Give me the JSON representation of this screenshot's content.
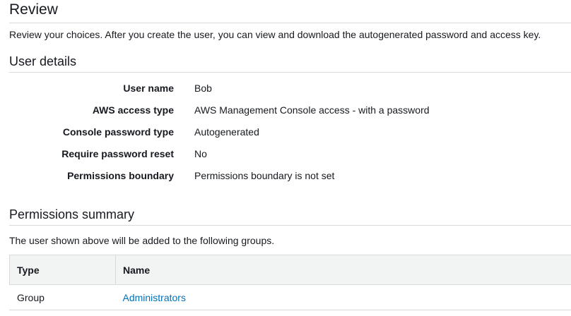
{
  "page": {
    "title": "Review",
    "intro": "Review your choices. After you create the user, you can view and download the autogenerated password and access key."
  },
  "user_details": {
    "title": "User details",
    "rows": [
      {
        "label": "User name",
        "value": "Bob"
      },
      {
        "label": "AWS access type",
        "value": "AWS Management Console access - with a password"
      },
      {
        "label": "Console password type",
        "value": "Autogenerated"
      },
      {
        "label": "Require password reset",
        "value": "No"
      },
      {
        "label": "Permissions boundary",
        "value": "Permissions boundary is not set"
      }
    ]
  },
  "permissions_summary": {
    "title": "Permissions summary",
    "intro": "The user shown above will be added to the following groups.",
    "table": {
      "headers": {
        "type": "Type",
        "name": "Name"
      },
      "rows": [
        {
          "type": "Group",
          "name": "Administrators"
        }
      ]
    }
  },
  "colors": {
    "link": "#0073bb",
    "header_bg": "#f2f3f3",
    "border": "#d5dbdb"
  }
}
